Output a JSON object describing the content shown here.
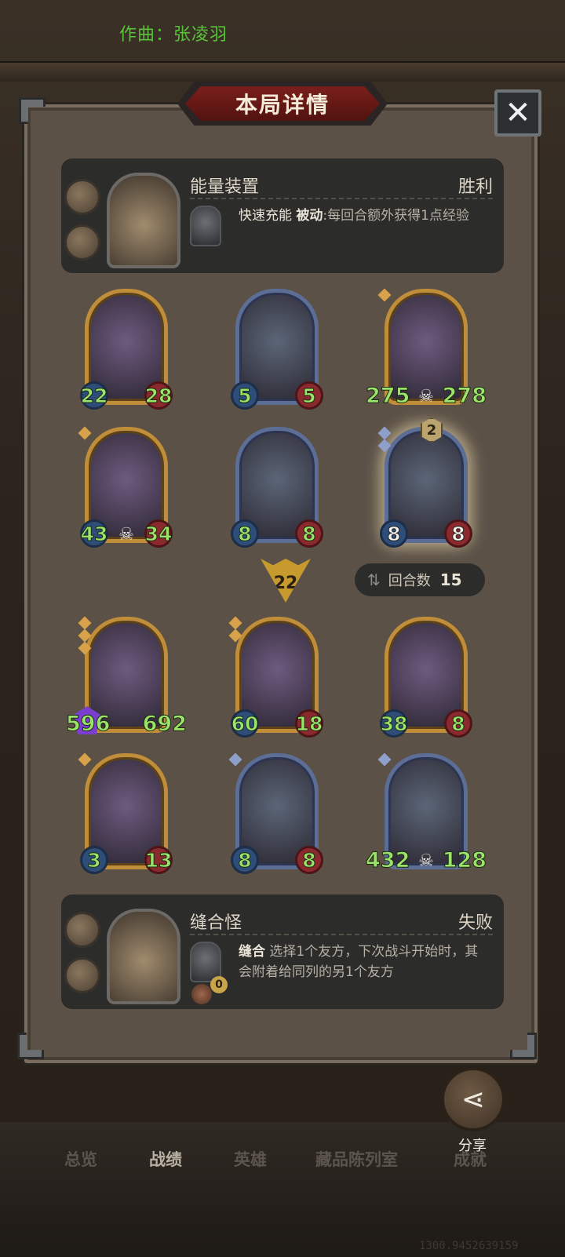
{
  "credit": "作曲：张凌羽",
  "title": "本局详情",
  "close_icon": "close-x-icon",
  "player_top": {
    "name": "能量装置",
    "result": "胜利",
    "ability_name": "快速充能",
    "ability_type": "被动",
    "ability_text": ":每回合额外获得1点经验"
  },
  "board_top": [
    {
      "frame": "gold",
      "attack": "22",
      "health": "28",
      "gems": 0,
      "skull": false
    },
    {
      "frame": "blue",
      "attack": "5",
      "health": "5",
      "gems": 0,
      "skull": false
    },
    {
      "frame": "gold",
      "attack": "275",
      "health": "278",
      "gems": 1,
      "skull": true
    },
    {
      "frame": "gold",
      "attack": "43",
      "health": "34",
      "gems": 1,
      "skull": true
    },
    {
      "frame": "blue",
      "attack": "8",
      "health": "8",
      "gems": 0,
      "skull": false
    },
    {
      "frame": "blue",
      "attack": "8",
      "health": "8",
      "gems": 2,
      "skull": false,
      "badge": "2",
      "glow": true
    }
  ],
  "damage": "22",
  "turns_label": "回合数",
  "turns_value": "15",
  "board_bottom": [
    {
      "frame": "gold",
      "attack": "596",
      "health": "692",
      "gems": 3,
      "skull": false,
      "purple": true
    },
    {
      "frame": "gold",
      "attack": "60",
      "health": "18",
      "gems": 2,
      "skull": false
    },
    {
      "frame": "gold",
      "attack": "38",
      "health": "8",
      "gems": 0,
      "skull": false
    },
    {
      "frame": "gold",
      "attack": "3",
      "health": "13",
      "gems": 1,
      "skull": false
    },
    {
      "frame": "blue",
      "attack": "8",
      "health": "8",
      "gems": 1,
      "skull": false
    },
    {
      "frame": "blue",
      "attack": "432",
      "health": "128",
      "gems": 1,
      "skull": true
    }
  ],
  "player_bottom": {
    "name": "缝合怪",
    "result": "失败",
    "ability_name": "缝合",
    "ability_text": "选择1个友方，下次战斗开始时，其会附着给同列的另1个友方",
    "ability_counter": "0"
  },
  "share_label": "分享",
  "nav": [
    "总览",
    "战绩",
    "英雄",
    "藏品陈列室",
    "成就"
  ],
  "nav_active": "战绩",
  "coords_text": "1300.9452639159"
}
